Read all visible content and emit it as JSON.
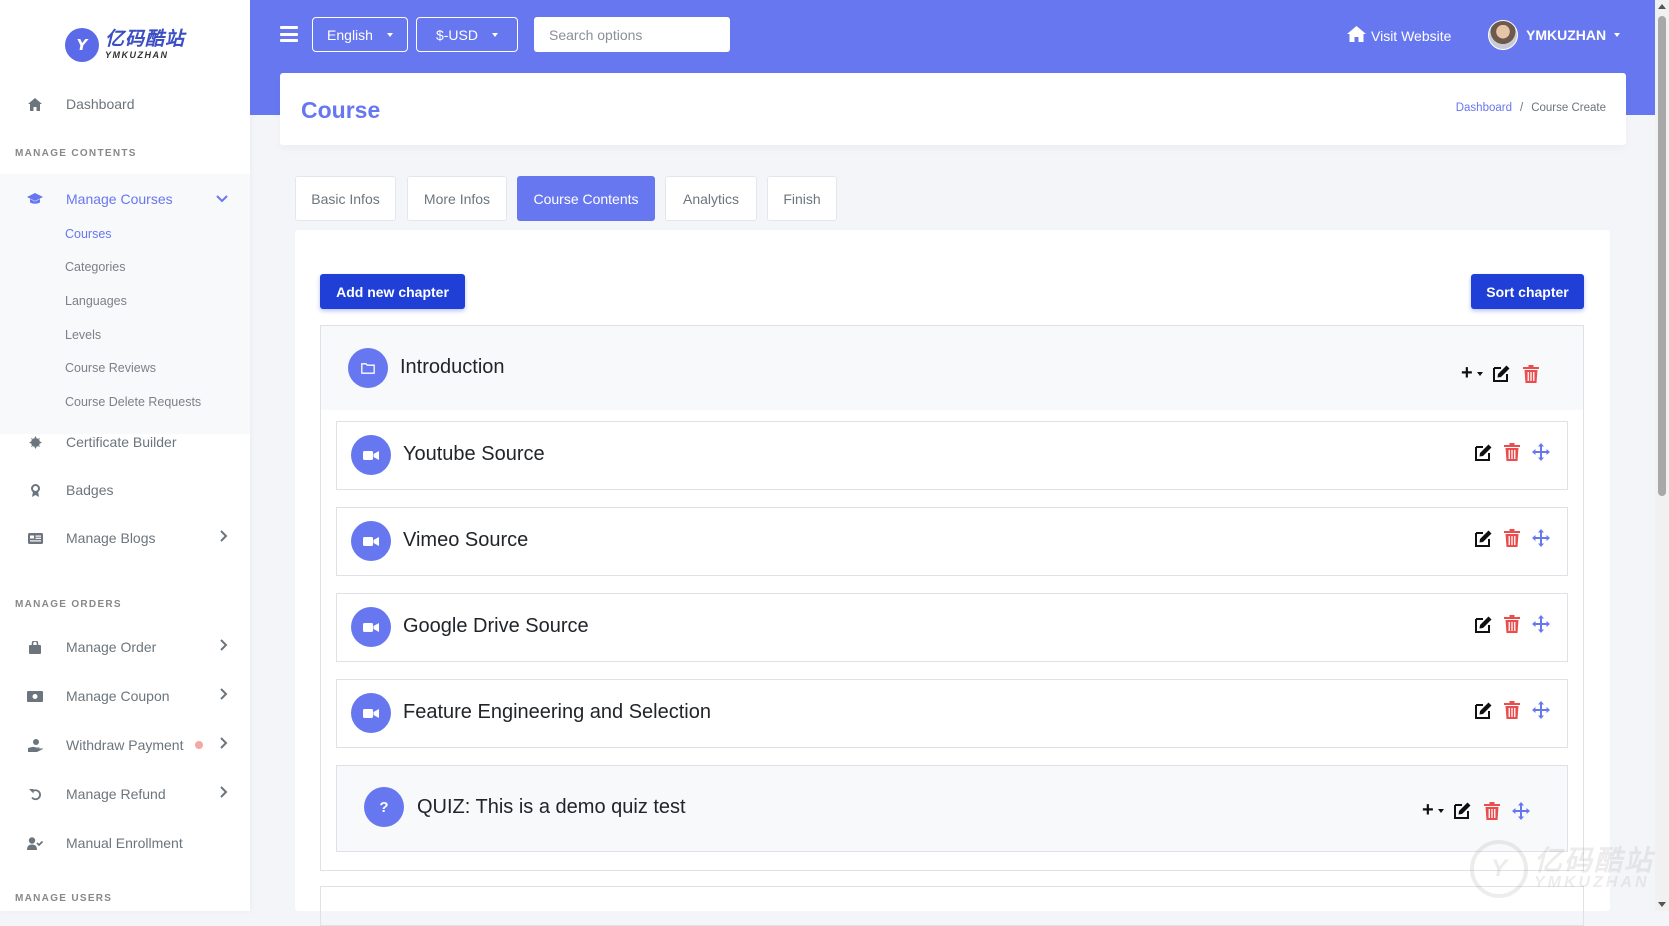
{
  "brand": {
    "logo_cn": "亿码酷站",
    "logo_en": "YMKUZHAN",
    "logo_mark": "Y"
  },
  "sidebar": {
    "dashboard": "Dashboard",
    "header_contents": "MANAGE CONTENTS",
    "manage_courses": "Manage Courses",
    "sub": [
      "Courses",
      "Categories",
      "Languages",
      "Levels",
      "Course Reviews",
      "Course Delete Requests"
    ],
    "certificate_builder": "Certificate Builder",
    "badges": "Badges",
    "manage_blogs": "Manage Blogs",
    "header_orders": "MANAGE ORDERS",
    "manage_order": "Manage Order",
    "manage_coupon": "Manage Coupon",
    "withdraw_payment": "Withdraw Payment",
    "manage_refund": "Manage Refund",
    "manual_enrollment": "Manual Enrollment",
    "header_users": "MANAGE USERS"
  },
  "topbar": {
    "language": "English",
    "currency": "$-USD",
    "search_placeholder": "Search options",
    "visit_website": "Visit Website",
    "user_name": "YMKUZHAN"
  },
  "page": {
    "title": "Course",
    "breadcrumb": {
      "home": "Dashboard",
      "separator": "/",
      "current": "Course Create"
    }
  },
  "tabs": [
    "Basic Infos",
    "More Infos",
    "Course Contents",
    "Analytics",
    "Finish"
  ],
  "actions": {
    "add_chapter": "Add new chapter",
    "sort_chapter": "Sort chapter"
  },
  "chapter": {
    "title": "Introduction",
    "lessons": [
      {
        "title": "Youtube Source",
        "type": "video"
      },
      {
        "title": "Vimeo Source",
        "type": "video"
      },
      {
        "title": "Google Drive Source",
        "type": "video"
      },
      {
        "title": "Feature Engineering and Selection",
        "type": "video"
      },
      {
        "title": "QUIZ: This is a demo quiz test",
        "type": "quiz",
        "badge": "?"
      }
    ]
  },
  "colors": {
    "primary": "#6777ef",
    "button": "#1f3fd6",
    "danger": "#ea4d4d"
  }
}
